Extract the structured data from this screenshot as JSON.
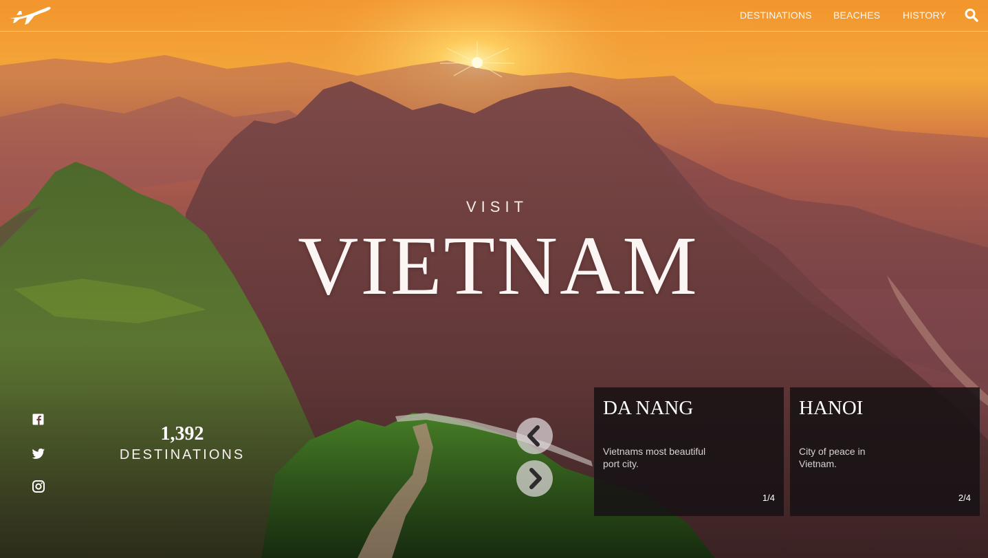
{
  "nav": {
    "logo_icon": "airplane-icon",
    "links": [
      "DESTINATIONS",
      "BEACHES",
      "HISTORY"
    ],
    "search_icon": "search-icon"
  },
  "hero": {
    "eyebrow": "VISIT",
    "title": "VIETNAM"
  },
  "social": {
    "icons": [
      "facebook-icon",
      "twitter-icon",
      "instagram-icon"
    ]
  },
  "stats": {
    "count": "1,392",
    "label": "DESTINATIONS"
  },
  "slider": {
    "prev_icon": "chevron-left-icon",
    "next_icon": "chevron-right-icon",
    "cards": [
      {
        "title": "DA NANG",
        "description": "Vietnams most beautiful port city.",
        "index": "1/4"
      },
      {
        "title": "HANOI",
        "description": "City of peace in Vietnam.",
        "index": "2/4"
      }
    ]
  },
  "colors": {
    "sky_top": "#f39a33",
    "sun": "#ffe680",
    "mountain": "#6e3d3e",
    "foliage": "#3f6b25",
    "card_bg": "#161214",
    "arrow_bg": "#e1dade"
  }
}
